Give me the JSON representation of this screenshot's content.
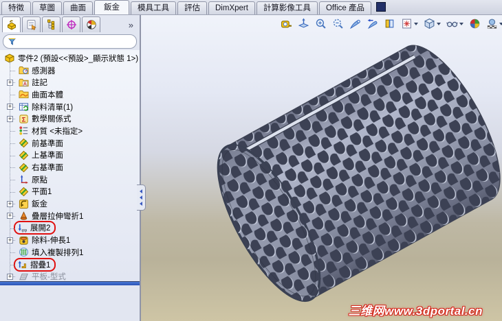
{
  "command_tabs": {
    "active_index": 3,
    "items": [
      {
        "label": "特徵"
      },
      {
        "label": "草圖"
      },
      {
        "label": "曲面"
      },
      {
        "label": "鈑金"
      },
      {
        "label": "模具工具"
      },
      {
        "label": "評估"
      },
      {
        "label": "DimXpert"
      },
      {
        "label": "計算影像工具"
      },
      {
        "label": "Office 產品"
      }
    ]
  },
  "panel_tabs": {
    "overflow_glyph": "»",
    "items": [
      {
        "icon": "featuremanager",
        "active": true
      },
      {
        "icon": "propertymanager",
        "active": false
      },
      {
        "icon": "configurationmanager",
        "active": false
      },
      {
        "icon": "dimxpertmanager",
        "active": false
      },
      {
        "icon": "displaymanager",
        "active": false
      }
    ]
  },
  "filter": {
    "value": "",
    "icon": "filter-funnel"
  },
  "feature_tree": {
    "root": {
      "label": "零件2 (預設<<預設>_顯示狀態 1>)",
      "icon": "part"
    },
    "items": [
      {
        "label": "感測器",
        "icon": "sensors"
      },
      {
        "label": "註記",
        "icon": "annotations",
        "expandable": true
      },
      {
        "label": "曲面本體",
        "icon": "surface-bodies"
      },
      {
        "label": "除料清單(1)",
        "icon": "cut-list",
        "expandable": true
      },
      {
        "label": "數學關係式",
        "icon": "equations",
        "expandable": true
      },
      {
        "label": "材質 <未指定>",
        "icon": "material"
      },
      {
        "label": "前基準面",
        "icon": "plane"
      },
      {
        "label": "上基準面",
        "icon": "plane"
      },
      {
        "label": "右基準面",
        "icon": "plane"
      },
      {
        "label": "原點",
        "icon": "origin"
      },
      {
        "label": "平面1",
        "icon": "plane"
      },
      {
        "label": "鈑金",
        "icon": "sheet-metal",
        "expandable": true
      },
      {
        "label": "疊層拉伸彎折1",
        "icon": "lofted-bend",
        "expandable": true
      },
      {
        "label": "展開2",
        "icon": "unfold",
        "highlighted": true
      },
      {
        "label": "除料-伸長1",
        "icon": "cut-extrude",
        "expandable": true
      },
      {
        "label": "填入複製排列1",
        "icon": "fill-pattern"
      },
      {
        "label": "摺疊1",
        "icon": "fold",
        "highlighted": true
      },
      {
        "label": "平板-型式",
        "icon": "flat-pattern",
        "expandable": true,
        "disabled": true
      }
    ]
  },
  "headsup_toolbar": {
    "items": [
      {
        "icon": "measure"
      },
      {
        "icon": "zoom-to-fit"
      },
      {
        "icon": "zoom-to-area"
      },
      {
        "icon": "zoom-previous"
      },
      {
        "icon": "view-telescope"
      },
      {
        "icon": "view-telescope-arrow"
      },
      {
        "icon": "section-view"
      },
      {
        "icon": "view-orientation",
        "caret": true
      },
      {
        "icon": "display-style",
        "caret": true
      },
      {
        "icon": "hide-show-items",
        "caret": true
      },
      {
        "icon": "edit-appearance"
      },
      {
        "icon": "apply-scene",
        "caret": true
      },
      {
        "icon": "view-settings"
      }
    ]
  },
  "ui": {
    "plus_glyph": "+"
  },
  "watermark": {
    "text": "三维网www.3dportal.cn",
    "color": "#d42a1e"
  },
  "colors": {
    "highlight_box": "#e01010",
    "splitter_blue": "#2f62c4",
    "model_surface": "#9aa0b6",
    "model_edge": "#3f4454",
    "background_top": "#f0f3fa",
    "background_bottom": "#cec5a5"
  }
}
